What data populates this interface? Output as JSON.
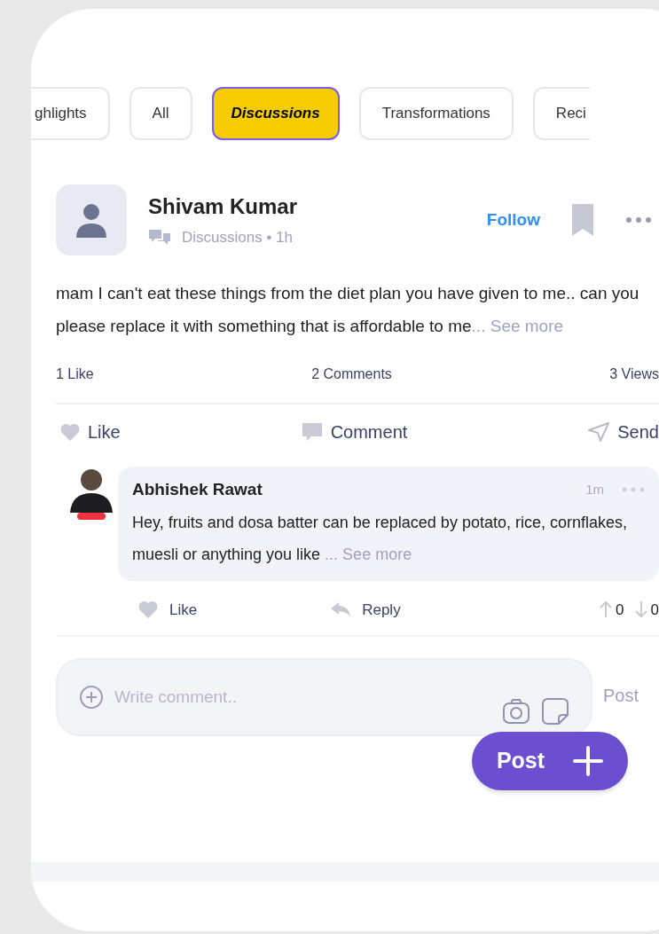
{
  "tabs": [
    {
      "label": "ghlights",
      "selected": false
    },
    {
      "label": "All",
      "selected": false
    },
    {
      "label": "Discussions",
      "selected": true
    },
    {
      "label": "Transformations",
      "selected": false
    },
    {
      "label": "Reci",
      "selected": false
    }
  ],
  "post": {
    "author": "Shivam Kumar",
    "meta": "Discussions • 1h",
    "follow": "Follow",
    "text": "mam I can't eat these things from the diet plan you have given to me.. can you please replace it with something that is affordable to me",
    "see_more": "... See more",
    "stats": [
      "1 Like",
      "2 Comments",
      "3 Views"
    ],
    "actions": [
      {
        "kind": "like",
        "label": "Like"
      },
      {
        "kind": "comment",
        "label": "Comment"
      },
      {
        "kind": "send",
        "label": "Send"
      }
    ]
  },
  "comment": {
    "author": "Abhishek Rawat",
    "time": "1m",
    "text": "Hey, fruits and dosa batter can be replaced by potato, rice, cornflakes, muesli or anything you like ",
    "see_more": "... See more",
    "like": "Like",
    "reply": "Reply",
    "upvotes": "0",
    "downvotes": "0"
  },
  "composer": {
    "placeholder": "Write comment..",
    "post": "Post"
  },
  "fab": {
    "label": "Post"
  }
}
